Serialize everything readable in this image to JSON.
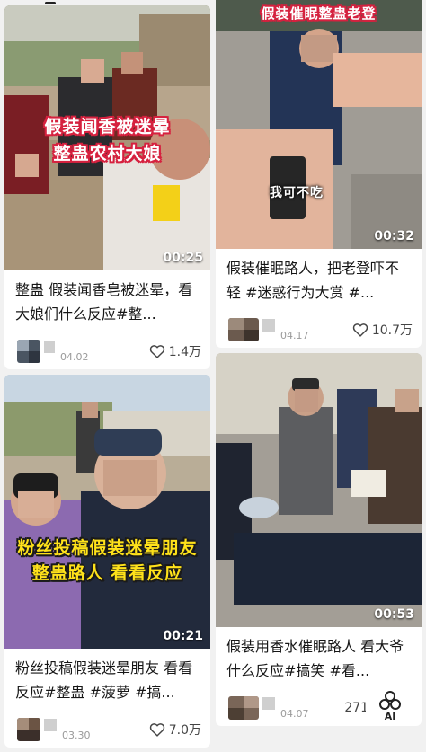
{
  "feed": [
    {
      "column": "left",
      "overlay_lines": [
        "假装闻香被迷晕",
        "整蛊农村大娘"
      ],
      "duration": "00:25",
      "title": "整蛊 假装闻香皂被迷晕，看大娘们什么反应#整...",
      "date": "04.02",
      "likes": "1.4万"
    },
    {
      "column": "left",
      "overlay_lines": [
        "粉丝投稿假装迷晕朋友",
        "整蛊路人 看看反应"
      ],
      "duration": "00:21",
      "title": "粉丝投稿假装迷晕朋友 看看反应#整蛊 #菠萝 #搞...",
      "date": "03.30",
      "likes": "7.0万"
    },
    {
      "column": "right",
      "overlay_top": "假装催眠整蛊老登",
      "overlay_caption": "我可不吃",
      "duration": "00:32",
      "title": "假装催眠路人，把老登吓不轻 #迷惑行为大赏 #...",
      "date": "04.17",
      "likes": "10.7万"
    },
    {
      "column": "right",
      "duration": "00:53",
      "title": "假装用香水催眠路人 看大爷什么反应#搞笑 #看...",
      "date": "04.07",
      "likes": "2716"
    }
  ],
  "ai_button": {
    "label": "AI"
  },
  "colors": {
    "background": "#f1f1f1",
    "card": "#ffffff",
    "title_text": "#161616",
    "meta_text": "#9a9a9a",
    "overlay_red": "#d6213f",
    "overlay_yellow": "#ffe21a"
  }
}
